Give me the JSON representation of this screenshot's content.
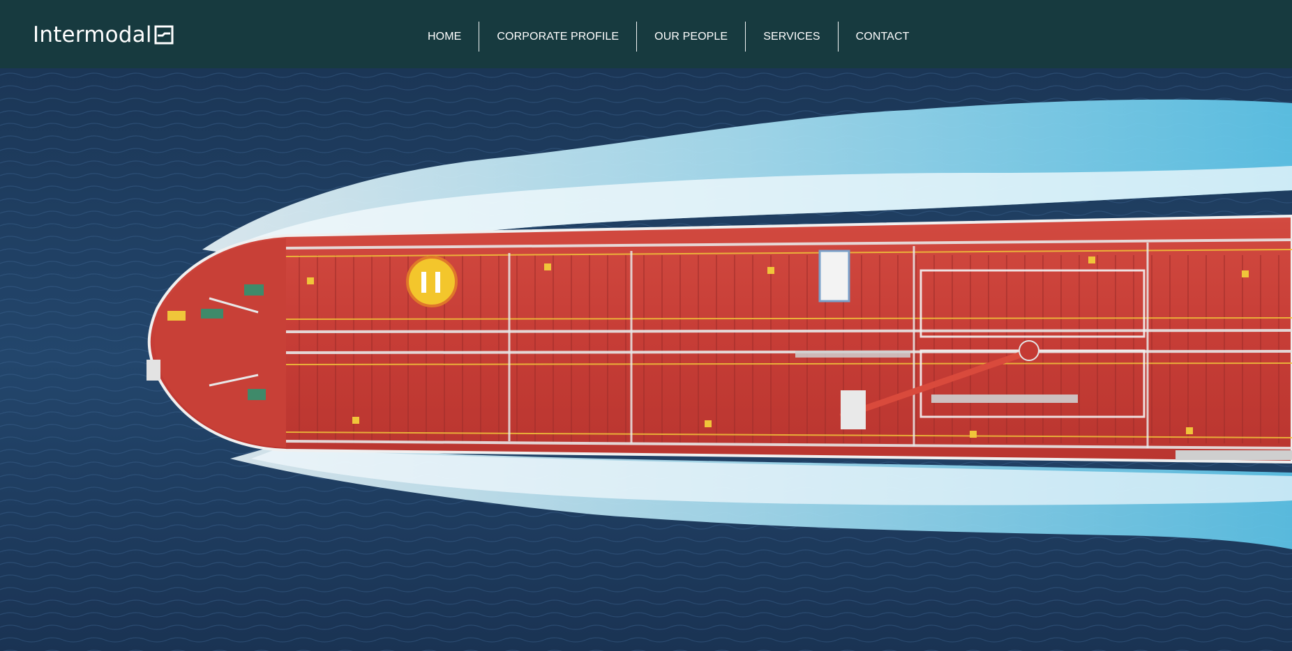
{
  "brand": {
    "name": "Intermodal",
    "logo_icon": "folded-box-icon"
  },
  "nav": {
    "items": [
      {
        "label": "HOME"
      },
      {
        "label": "CORPORATE PROFILE"
      },
      {
        "label": "OUR PEOPLE"
      },
      {
        "label": "SERVICES"
      },
      {
        "label": "CONTACT"
      }
    ]
  },
  "hero": {
    "image_subject": "aerial view of red tanker ship at sea"
  },
  "colors": {
    "header_bg": "#173a3f",
    "sea": "#1f3a5c",
    "hull": "#c9403a",
    "deck_lines": "#f0c53a",
    "wake": "#8fd3ec"
  }
}
